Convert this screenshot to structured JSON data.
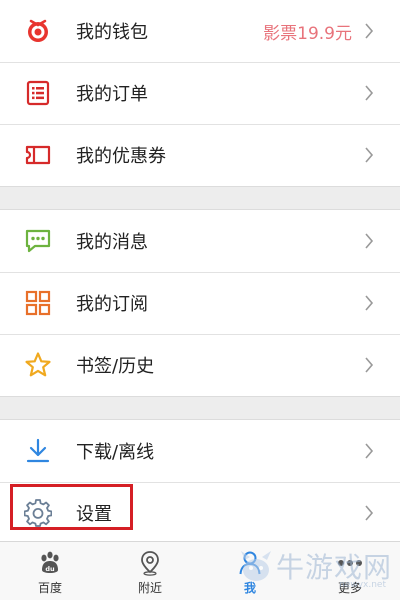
{
  "menu": {
    "section1": [
      {
        "label": "我的钱包",
        "value": "影票19.9元",
        "icon": "wallet-logo-icon"
      },
      {
        "label": "我的订单",
        "icon": "order-list-icon"
      },
      {
        "label": "我的优惠券",
        "icon": "coupon-ticket-icon"
      }
    ],
    "section2": [
      {
        "label": "我的消息",
        "icon": "message-bubble-icon"
      },
      {
        "label": "我的订阅",
        "icon": "grid-subscribe-icon"
      },
      {
        "label": "书签/历史",
        "icon": "star-icon"
      }
    ],
    "section3": [
      {
        "label": "下载/离线",
        "icon": "download-icon"
      },
      {
        "label": "设置",
        "icon": "gear-icon"
      }
    ]
  },
  "tabbar": {
    "tabs": [
      {
        "label": "百度",
        "icon": "baidu-paw-icon"
      },
      {
        "label": "附近",
        "icon": "location-pin-icon"
      },
      {
        "label": "我",
        "icon": "person-icon",
        "active": true
      },
      {
        "label": "更多",
        "icon": "more-dots-icon"
      }
    ]
  },
  "watermark": {
    "text": "牛游戏网",
    "sub": "newyx.net"
  },
  "colors": {
    "accent_blue": "#2f86e0",
    "value_pink": "#e8737b",
    "highlight_red": "#d51f25"
  }
}
